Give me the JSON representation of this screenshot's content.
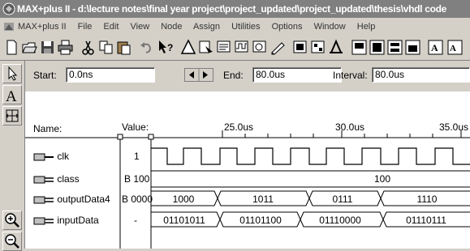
{
  "window": {
    "title": "MAX+plus II - d:\\lecture notes\\final year project\\project_updated\\project_updated\\thesis\\vhdl code"
  },
  "menubar": {
    "items": [
      "MAX+plus II",
      "File",
      "Edit",
      "View",
      "Node",
      "Assign",
      "Utilities",
      "Options",
      "Window",
      "Help"
    ]
  },
  "toolbar": {
    "icons": [
      "new-icon",
      "open-icon",
      "save-icon",
      "print-icon",
      "cut-icon",
      "copy-icon",
      "paste-icon",
      "undo-icon",
      "context-help-icon",
      "hierarchy-icon",
      "project-icon",
      "compile-icon",
      "simulate-icon",
      "timing-icon",
      "programmer-icon",
      "waveform-icon",
      "floorplan-icon",
      "symbol-icon",
      "text-icon",
      "graphic-icon",
      "open-waveform-icon",
      "print-waveform-icon",
      "font-icon",
      "font-size-icon"
    ]
  },
  "timing": {
    "start_label": "Start:",
    "start_value": "0.0ns",
    "end_label": "End:",
    "end_value": "80.0us",
    "interval_label": "Interval:",
    "interval_value": "80.0us"
  },
  "header": {
    "name_label": "Name:",
    "value_label": "Value:",
    "ticks": [
      "25.0us",
      "30.0us",
      "35.0us"
    ]
  },
  "signals": [
    {
      "name": "clk",
      "value": "1",
      "type": "input-single"
    },
    {
      "name": "class",
      "value": "B 100",
      "type": "input-group"
    },
    {
      "name": "outputData4",
      "value": "B 0000",
      "type": "output-group"
    },
    {
      "name": "inputData",
      "value": "-",
      "type": "bidir-group"
    }
  ],
  "waves": {
    "class_label": "100",
    "output_labels": [
      "1000",
      "1011",
      "0111",
      "1110"
    ],
    "input_labels": [
      "01101011",
      "01101100",
      "01110000",
      "01110111"
    ]
  }
}
